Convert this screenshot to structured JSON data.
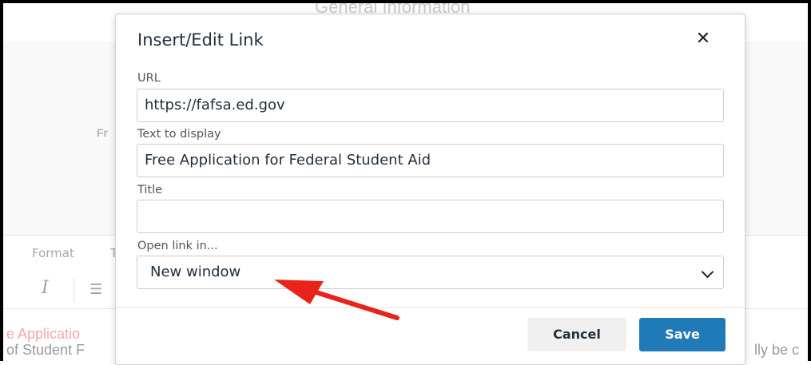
{
  "background": {
    "heading": "General Information",
    "fragment_fr": "Fr",
    "menu_format": "Format",
    "menu_t": "T",
    "italic_glyph": "I",
    "list_glyph": "☰",
    "editor_line1": "e Applicatio",
    "editor_line2": "of Student F",
    "editor_line2_right": "lly be c"
  },
  "dialog": {
    "title": "Insert/Edit Link",
    "close_glyph": "✕",
    "url_label": "URL",
    "url_value": "https://fafsa.ed.gov",
    "text_label": "Text to display",
    "text_value": "Free Application for Federal Student Aid",
    "title_label": "Title",
    "title_value": "",
    "open_label": "Open link in...",
    "open_value": "New window",
    "cancel_label": "Cancel",
    "save_label": "Save"
  },
  "colors": {
    "accent": "#207ab7",
    "annotation_arrow": "#e8231c"
  },
  "icons": [
    "close-icon",
    "chevron-down-icon",
    "italic-icon",
    "list-icon"
  ]
}
